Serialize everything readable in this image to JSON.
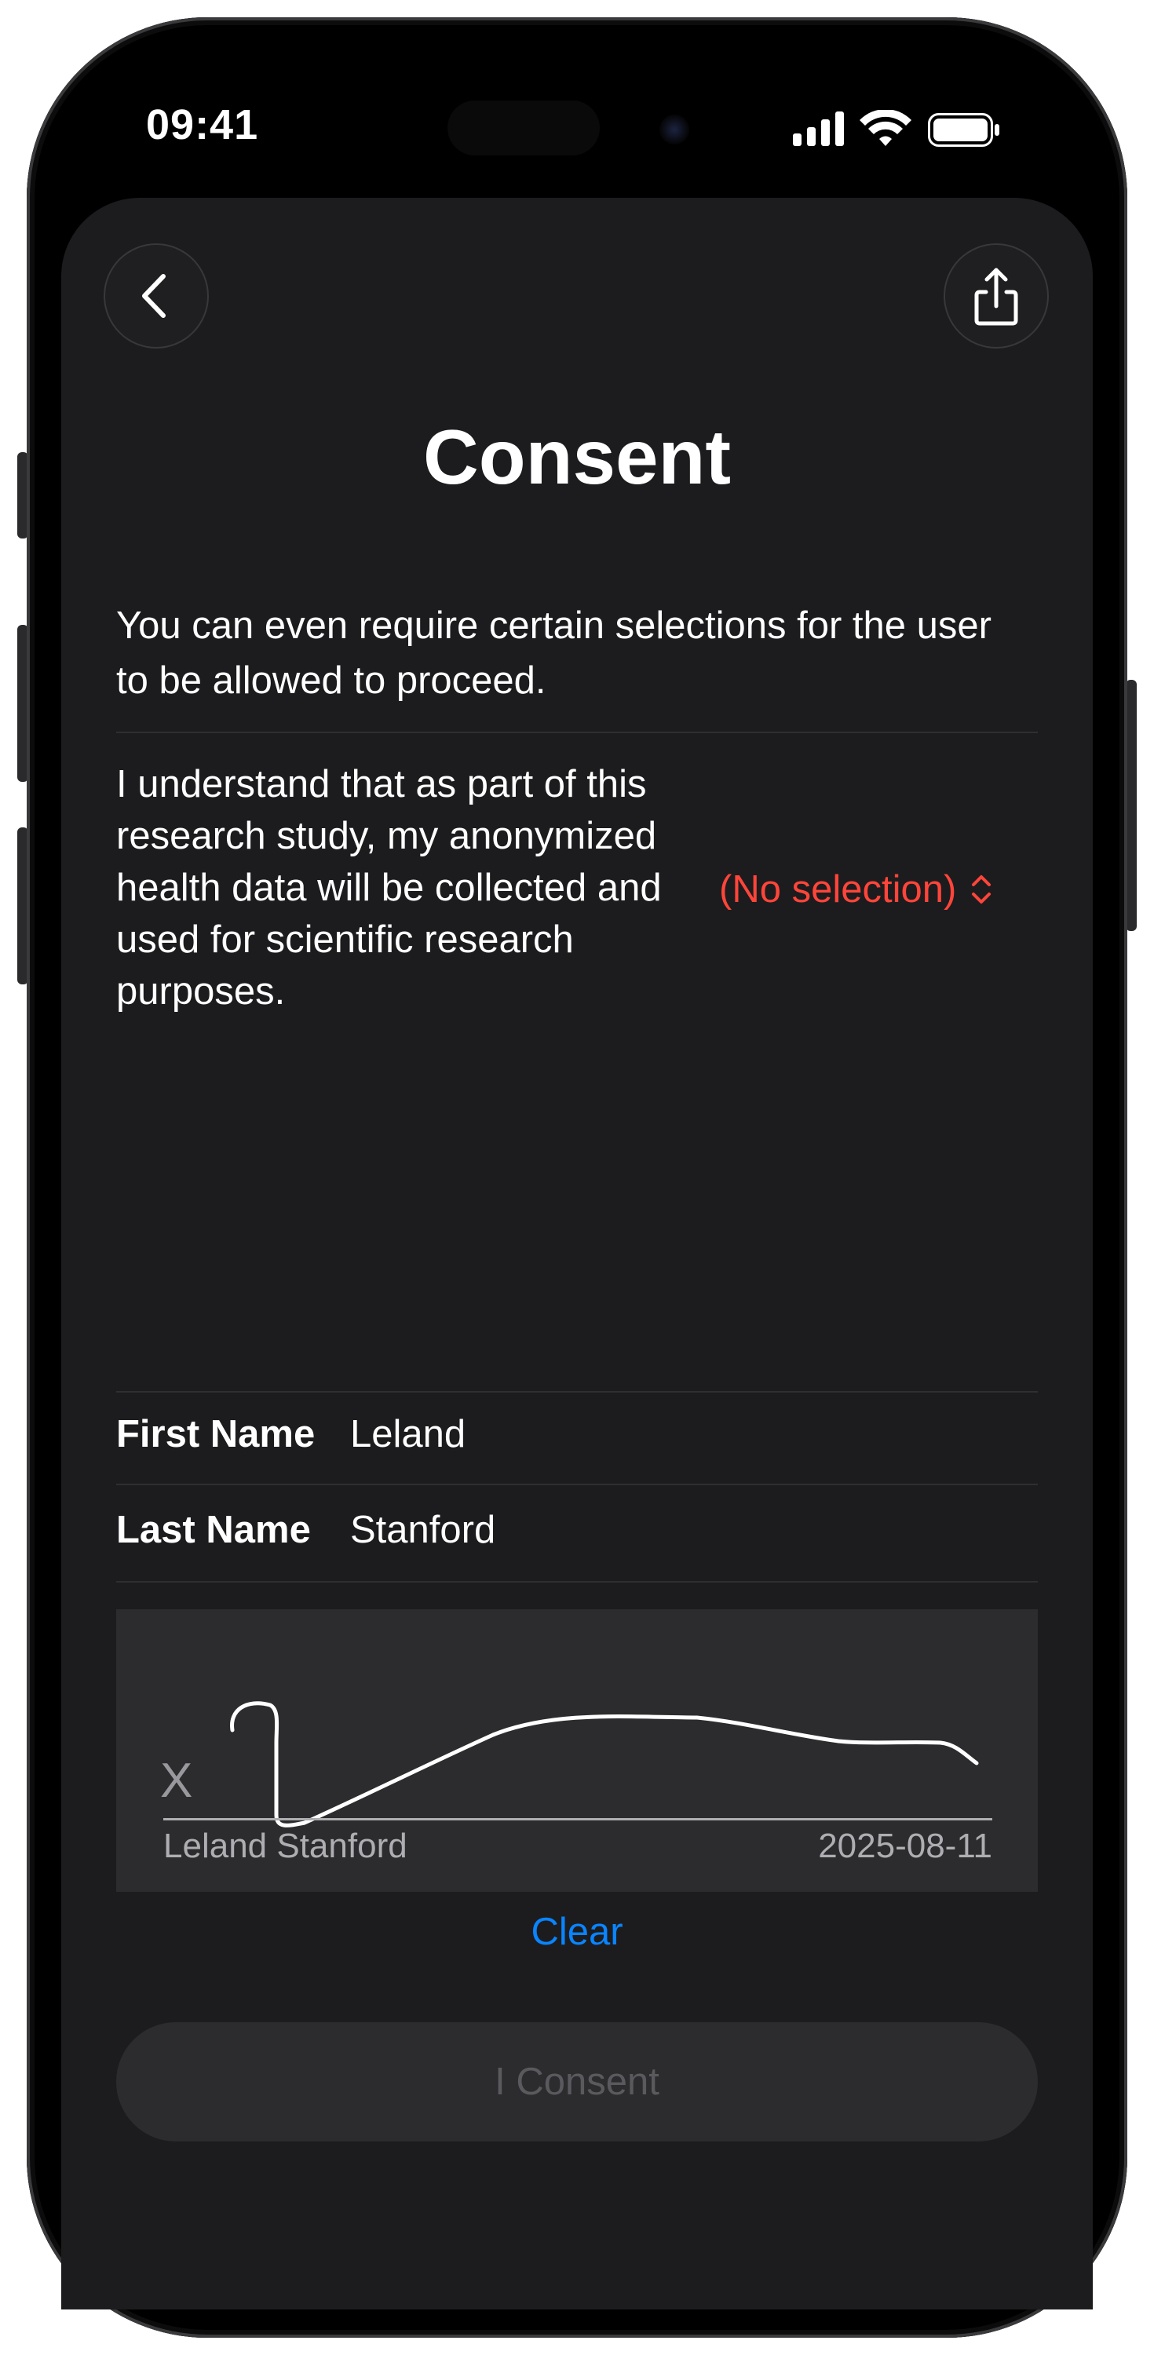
{
  "status_bar": {
    "time": "09:41",
    "icons": [
      "cellular-signal-icon",
      "wifi-icon",
      "battery-icon"
    ]
  },
  "nav": {
    "back_icon": "chevron-left-icon",
    "share_icon": "share-icon"
  },
  "page": {
    "title": "Consent",
    "intro": "You can even require certain selections for the user to be allowed to proceed."
  },
  "consent_item": {
    "text": "I understand that as part of this research study, my anonymized health data will be collected and used for scientific research purposes.",
    "selection": "(No selection)",
    "selection_icon": "chevron-up-down-icon"
  },
  "form": {
    "first_name_label": "First Name",
    "first_name_value": "Leland",
    "last_name_label": "Last Name",
    "last_name_value": "Stanford"
  },
  "signature": {
    "mark": "X",
    "name": "Leland Stanford",
    "date": "2025-08-11"
  },
  "actions": {
    "clear_label": "Clear",
    "consent_label": "I Consent"
  },
  "colors": {
    "background": "#1c1c1e",
    "destructive": "#ff453a",
    "link": "#0a84ff",
    "disabled_text": "#5a5a5e"
  }
}
